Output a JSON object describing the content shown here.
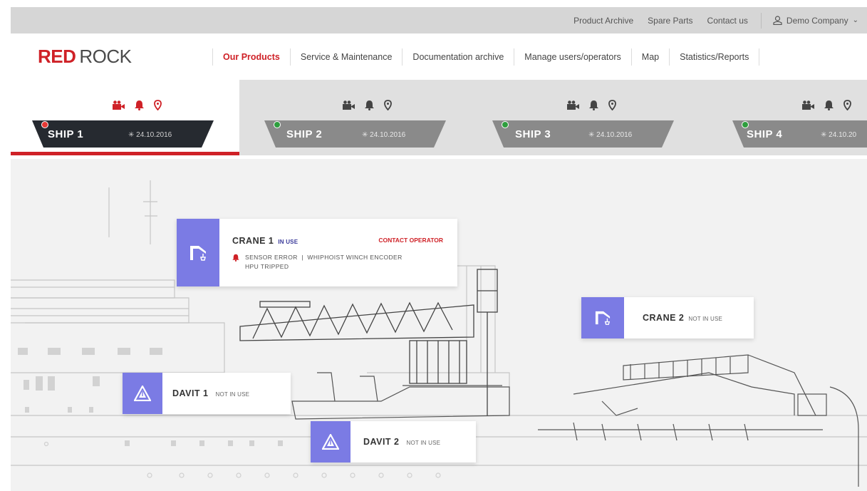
{
  "topbar": {
    "links": [
      "Product Archive",
      "Spare Parts",
      "Contact us"
    ],
    "company": "Demo Company"
  },
  "logo": {
    "part1": "RED",
    "part2": "ROCK"
  },
  "nav": {
    "items": [
      "Our Products",
      "Service & Maintenance",
      "Documentation archive",
      "Manage users/operators",
      "Map",
      "Statistics/Reports"
    ],
    "active": "Our Products"
  },
  "ships": [
    {
      "name": "SHIP 1",
      "date": "24.10.2016",
      "status_color": "#e53935",
      "active": true,
      "hull_color": "#262a30"
    },
    {
      "name": "SHIP 2",
      "date": "24.10.2016",
      "status_color": "#2e9e3e",
      "active": false,
      "hull_color": "#8a8a8a"
    },
    {
      "name": "SHIP 3",
      "date": "24.10.2016",
      "status_color": "#2e9e3e",
      "active": false,
      "hull_color": "#8a8a8a"
    },
    {
      "name": "SHIP 4",
      "date": "24.10.20",
      "status_color": "#2e9e3e",
      "active": false,
      "hull_color": "#8a8a8a"
    }
  ],
  "equipment": {
    "crane1": {
      "name": "CRANE 1",
      "status": "IN USE",
      "action": "CONTACT OPERATOR",
      "error_line1": "SENSOR ERROR  |  WHIPHOIST WINCH ENCODER",
      "error_line2": "HPU TRIPPED"
    },
    "crane2": {
      "name": "CRANE 2",
      "status": "NOT IN USE"
    },
    "davit1": {
      "name": "DAVIT 1",
      "status": "NOT IN USE"
    },
    "davit2": {
      "name": "DAVIT 2",
      "status": "NOT IN USE"
    }
  },
  "colors": {
    "brand_red": "#cf2127",
    "accent_purple": "#7b7be4",
    "tab_bg": "#e0e0e0"
  },
  "icons": {
    "tab_icons": [
      "camera-icon",
      "bell-icon",
      "location-pin-icon"
    ],
    "date_icon": "snowflake-icon",
    "crane_icon": "crane-icon",
    "davit_icon": "davit-icon"
  }
}
